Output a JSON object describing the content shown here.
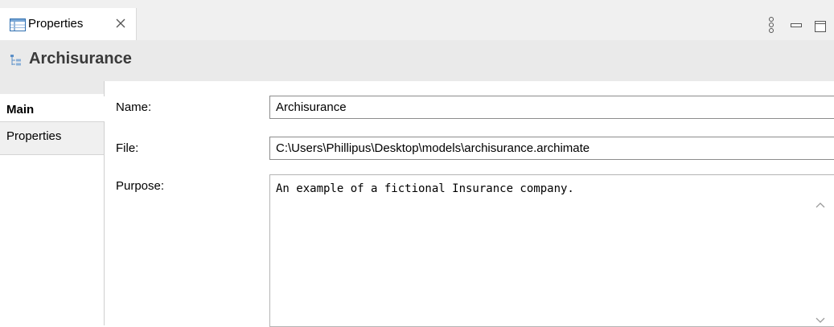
{
  "view_tab": {
    "label": "Properties",
    "icon": "properties-view-icon",
    "close_icon": "close-icon"
  },
  "view_controls": [
    "view-menu-icon",
    "minimize-icon",
    "maximize-icon"
  ],
  "title": {
    "text": "Archisurance",
    "icon": "model-tree-icon"
  },
  "side_tabs": [
    {
      "label": "Main",
      "selected": true
    },
    {
      "label": "Properties",
      "selected": false
    }
  ],
  "form": {
    "name_label": "Name:",
    "name_value": "Archisurance",
    "file_label": "File:",
    "file_value": "C:\\Users\\Phillipus\\Desktop\\models\\archisurance.archimate",
    "purpose_label": "Purpose:",
    "purpose_value": "An example of a fictional Insurance company."
  },
  "colors": {
    "tab_bar_bg": "#f0f0f0",
    "title_bar_bg": "#eaeaea",
    "field_border": "#8c8c8c"
  }
}
